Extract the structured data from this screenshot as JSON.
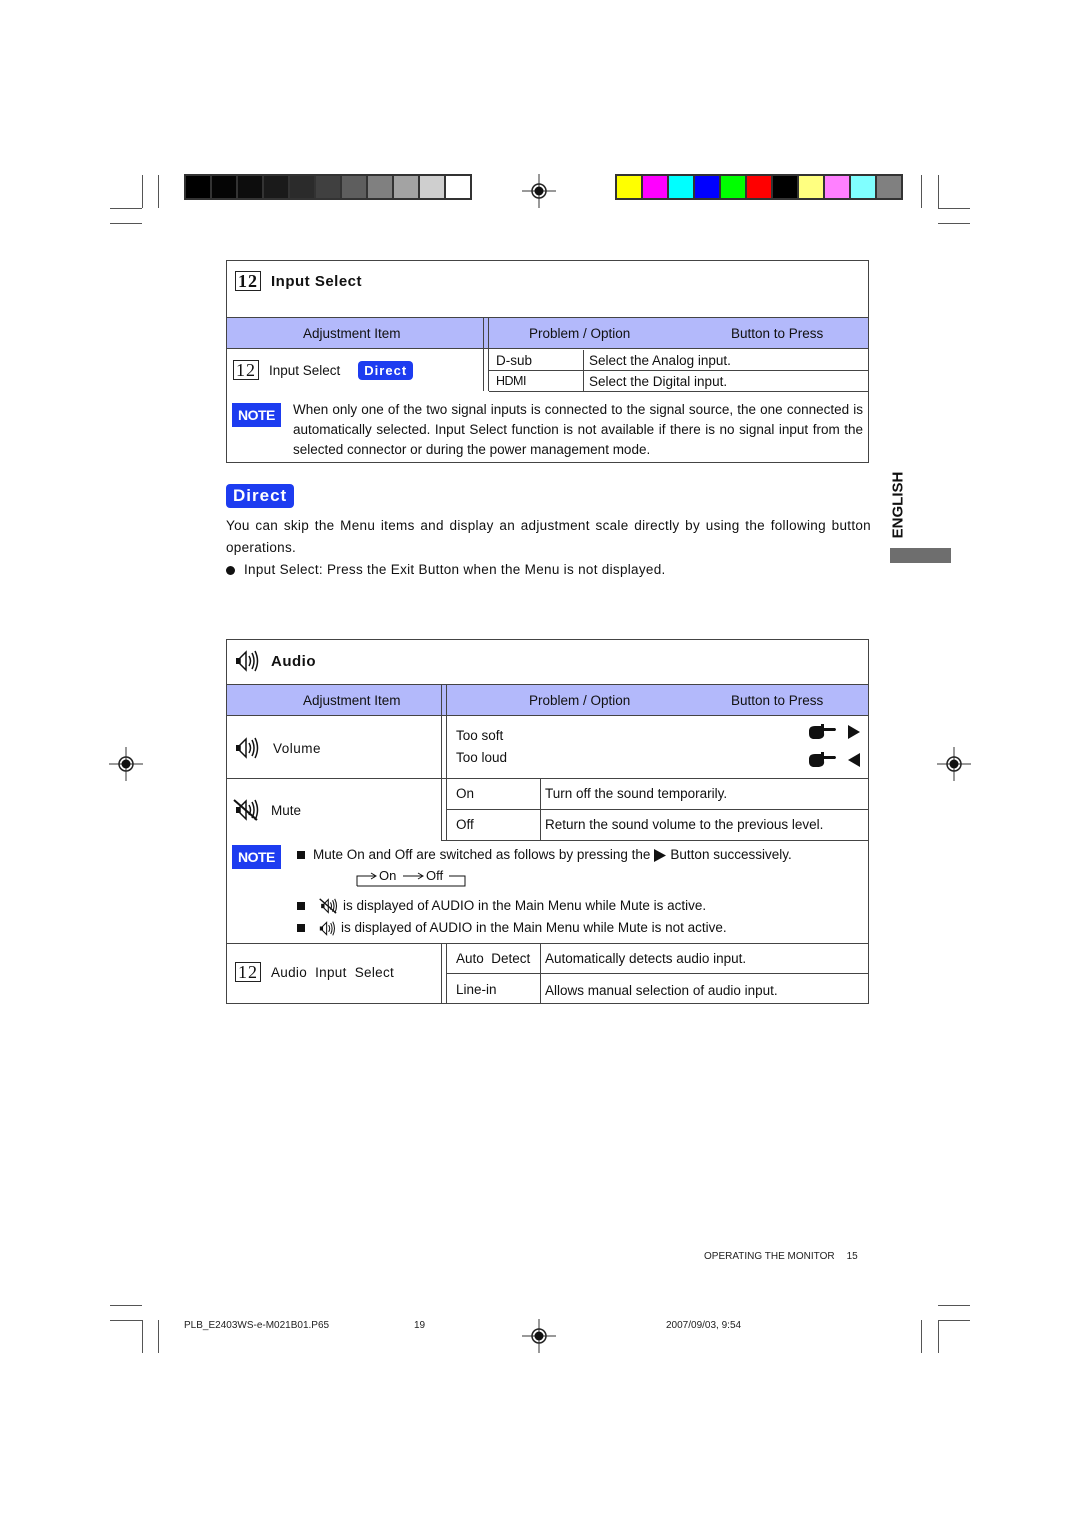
{
  "print_marks": {
    "grayscale_swatches": [
      "#000000",
      "#050505",
      "#0d0d0d",
      "#1a1a1a",
      "#2b2b2b",
      "#404040",
      "#5e5e5e",
      "#808080",
      "#a3a3a3",
      "#cfcfcf",
      "#ffffff"
    ],
    "color_swatches": [
      "#ffff00",
      "#ff00ff",
      "#00ffff",
      "#0000ff",
      "#00ff00",
      "#ff0000",
      "#000000",
      "#ffff80",
      "#ff80ff",
      "#80ffff",
      "#808080"
    ]
  },
  "input_select": {
    "icon_number": "12",
    "title": "Input Select",
    "headers": {
      "adjustment_item": "Adjustment Item",
      "problem_option": "Problem / Option",
      "button_to_press": "Button to Press"
    },
    "row": {
      "icon_number": "12",
      "label": "Input Select",
      "badge": "Direct",
      "options": [
        {
          "option": "D-sub",
          "description": "Select the Analog input."
        },
        {
          "option": "HDMI",
          "description": "Select the Digital input."
        }
      ]
    },
    "note_label": "NOTE",
    "note_text": "When only one of the two signal inputs is connected to the signal source, the one connected is automatically selected. Input Select function is not available if there is no signal input from the selected connector or during the power management mode."
  },
  "direct": {
    "badge": "Direct",
    "description": "You can skip the Menu items and display an adjustment scale directly by using the following button operations.",
    "bullet": "Input Select: Press the Exit Button when the Menu is not displayed."
  },
  "side_tab": {
    "language": "ENGLISH"
  },
  "audio": {
    "title": "Audio",
    "headers": {
      "adjustment_item": "Adjustment Item",
      "problem_option": "Problem / Option",
      "button_to_press": "Button to Press"
    },
    "volume": {
      "label": "Volume",
      "too_soft": "Too  soft",
      "too_loud": "Too loud"
    },
    "mute": {
      "label": "Mute",
      "options": [
        {
          "option": "On",
          "description": "Turn off the sound temporarily."
        },
        {
          "option": "Off",
          "description": "Return the sound volume to the previous level."
        }
      ]
    },
    "note_label": "NOTE",
    "note_line1_a": "Mute On and Off are switched as follows by pressing the",
    "note_line1_b": "Button successively.",
    "cycle_on": "On",
    "cycle_off": "Off",
    "note_line2": "is displayed of AUDIO in the Main Menu while Mute is active.",
    "note_line3": "is displayed of AUDIO in the Main Menu while Mute is not active.",
    "audio_input_select": {
      "icon_number": "12",
      "label": "Audio  Input  Select",
      "options": [
        {
          "option": "Auto  Detect",
          "description": "Automatically detects audio input."
        },
        {
          "option": "Line-in",
          "description": "Allows manual selection of audio input."
        }
      ]
    }
  },
  "page_footer": {
    "section": "OPERATING THE MONITOR",
    "page_number": "15"
  },
  "print_footer": {
    "filename": "PLB_E2403WS-e-M021B01.P65",
    "sheet": "19",
    "datetime": "2007/09/03, 9:54"
  }
}
